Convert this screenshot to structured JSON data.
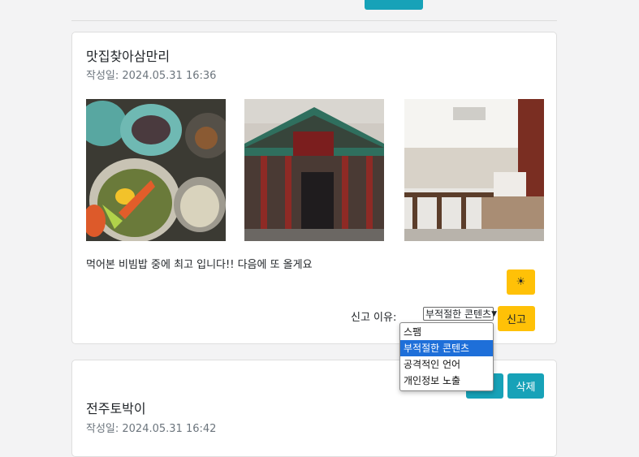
{
  "post1": {
    "title": "맛집찾아삼만리",
    "date": "작성일: 2024.05.31 16:36",
    "content": "먹어본 비빔밥 중에 최고 입니다!! 다음에 또 올게요",
    "sun_label": "☀",
    "report_label": "신고 이유:",
    "report_selected": "부적절한 콘텐츠",
    "report_button": "신고",
    "images": [
      "bibimbap-photo",
      "restaurant-exterior-photo",
      "restaurant-interior-photo"
    ]
  },
  "report_options": [
    "스팸",
    "부적절한 콘텐츠",
    "공격적인 언어",
    "개인정보 노출"
  ],
  "post2": {
    "title": "전주토박이",
    "date": "작성일: 2024.05.31 16:42",
    "delete_button": "삭제"
  },
  "colors": {
    "warning": "#ffc107",
    "info": "#17a2b8",
    "select_highlight": "#1e6fd9"
  }
}
